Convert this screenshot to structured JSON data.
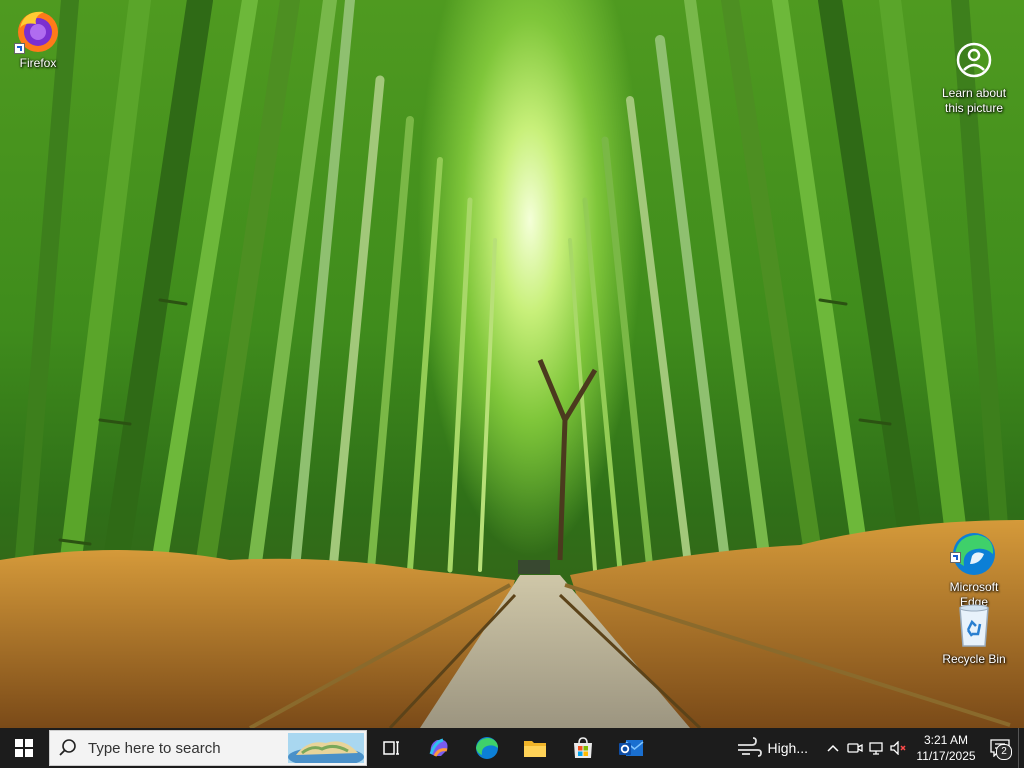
{
  "desktop": {
    "icons": [
      {
        "label": "Firefox"
      },
      {
        "label": "Learn about\nthis picture"
      },
      {
        "label": "Microsoft\nEdge"
      },
      {
        "label": "Recycle Bin"
      }
    ]
  },
  "taskbar": {
    "search": {
      "placeholder": "Type here to search"
    },
    "pinned": [
      "task-view",
      "copilot",
      "edge",
      "file-explorer",
      "microsoft-store",
      "outlook"
    ],
    "weather": {
      "label": "High..."
    },
    "clock": {
      "time": "3:21 AM",
      "date": "11/17/2025"
    },
    "notifications": {
      "count": "2"
    }
  },
  "colors": {
    "taskbar_bg": "#1c1c1c",
    "search_bg": "#f3f3f3",
    "wallpaper_green": "#3f8c1c"
  }
}
